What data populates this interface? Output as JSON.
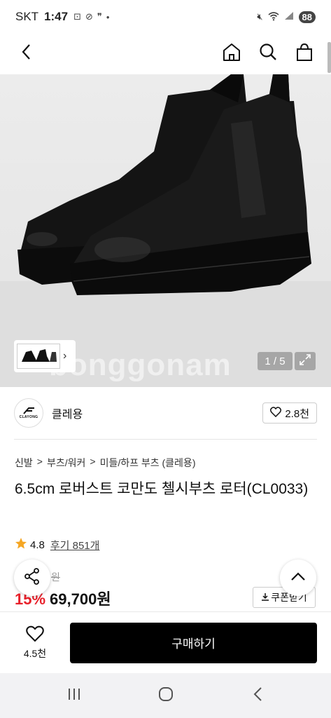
{
  "status_bar": {
    "carrier": "SKT",
    "time": "1:47",
    "battery": "88"
  },
  "icons": {
    "back": "chevron-left-icon",
    "home": "home-icon",
    "search": "search-icon",
    "bag": "shopping-bag-icon"
  },
  "gallery": {
    "counter": "1 / 5",
    "watermark": "bonggonam"
  },
  "brand": {
    "logo_text": "CLAYONG",
    "name": "클레용",
    "likes": "2.8천"
  },
  "breadcrumb": [
    "신발",
    "부츠/워커",
    "미들/하프 부츠 (클레용)"
  ],
  "breadcrumb_separator": ">",
  "product": {
    "title": "6.5cm 로버스트 코만도 첼시부츠 로터(CL0033)",
    "rating": "4.8",
    "reviews": "후기 851개",
    "original_price": "원",
    "discount": "15%",
    "price": "69,700원",
    "coupon_label": "쿠폰받기"
  },
  "bottom_bar": {
    "wish_count": "4.5천",
    "buy_label": "구매하기"
  },
  "colors": {
    "accent": "#e8212b",
    "buy_button": "#000000",
    "star": "#f5a623"
  }
}
